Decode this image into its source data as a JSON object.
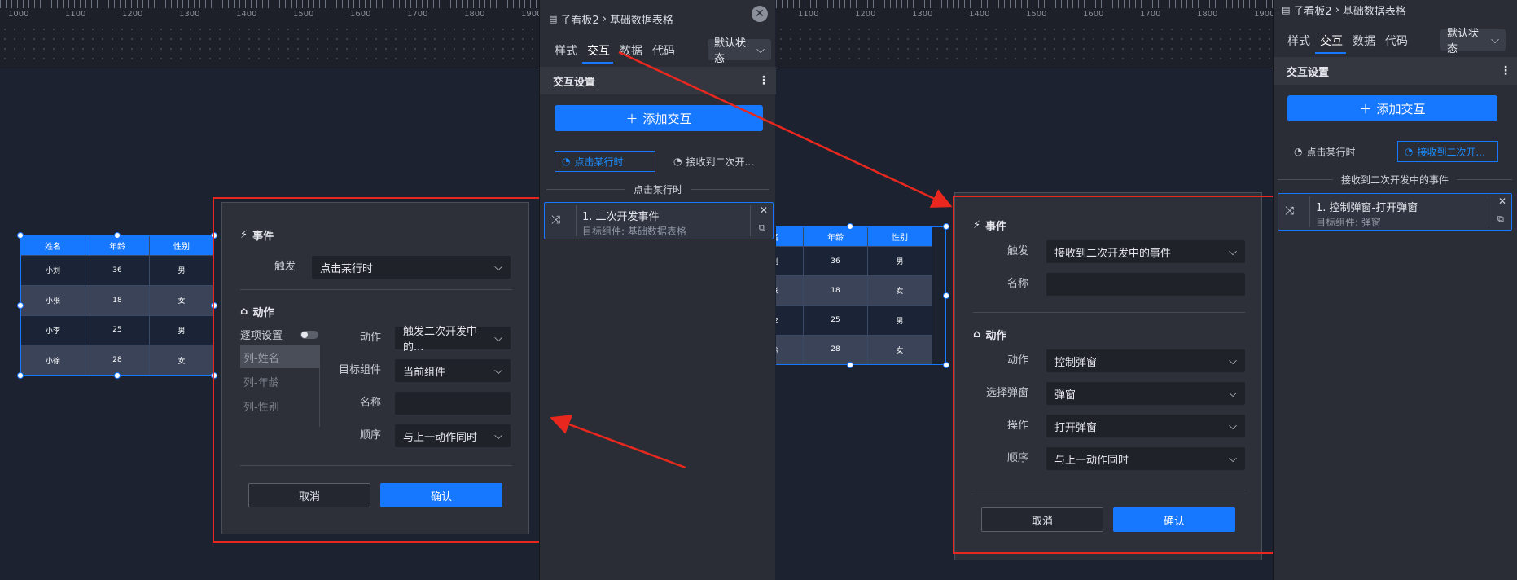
{
  "left_ruler": [
    "1000",
    "1100",
    "1200",
    "1300",
    "1400",
    "1500",
    "1600",
    "1700",
    "1800",
    "1900"
  ],
  "right_ruler": [
    "1100",
    "1200",
    "1300",
    "1400",
    "1500",
    "1600",
    "1700",
    "1800",
    "1900"
  ],
  "table": {
    "headers": [
      "姓名",
      "年龄",
      "性别"
    ],
    "rows": [
      [
        "小刘",
        "36",
        "男"
      ],
      [
        "小张",
        "18",
        "女"
      ],
      [
        "小李",
        "25",
        "男"
      ],
      [
        "小徐",
        "28",
        "女"
      ]
    ]
  },
  "panel_a": {
    "breadcrumb_parent": "子看板2",
    "breadcrumb_current": "基础数据表格",
    "tabs": [
      "样式",
      "交互",
      "数据",
      "代码"
    ],
    "state": "默认状态",
    "section_title": "交互设置",
    "add_button": "添加交互",
    "trigger_click": "点击某行时",
    "trigger_receive": "接收到二次开...",
    "group_label": "点击某行时",
    "card_title": "1. 二次开发事件",
    "card_sub": "目标组件: 基础数据表格"
  },
  "panel_b": {
    "breadcrumb_parent": "子看板2",
    "breadcrumb_current": "基础数据表格",
    "tabs": [
      "样式",
      "交互",
      "数据",
      "代码"
    ],
    "state": "默认状态",
    "section_title": "交互设置",
    "add_button": "添加交互",
    "trigger_click": "点击某行时",
    "trigger_receive": "接收到二次开...",
    "group_label": "接收到二次开发中的事件",
    "card_title": "1. 控制弹窗-打开弹窗",
    "card_sub": "目标组件: 弹窗"
  },
  "dialog_a": {
    "event_title": "事件",
    "trigger_label": "触发",
    "trigger_value": "点击某行时",
    "action_title": "动作",
    "per_item": "逐项设置",
    "columns": [
      "列-姓名",
      "列-年龄",
      "列-性别"
    ],
    "action_label": "动作",
    "action_value": "触发二次开发中的...",
    "target_label": "目标组件",
    "target_value": "当前组件",
    "name_label": "名称",
    "name_value": "",
    "order_label": "顺序",
    "order_value": "与上一动作同时",
    "cancel": "取消",
    "confirm": "确认"
  },
  "dialog_b": {
    "event_title": "事件",
    "trigger_label": "触发",
    "trigger_value": "接收到二次开发中的事件",
    "name_label": "名称",
    "name_value": "",
    "action_title": "动作",
    "action_label": "动作",
    "action_value": "控制弹窗",
    "popup_label": "选择弹窗",
    "popup_value": "弹窗",
    "op_label": "操作",
    "op_value": "打开弹窗",
    "order_label": "顺序",
    "order_value": "与上一动作同时",
    "cancel": "取消",
    "confirm": "确认"
  },
  "colors": {
    "accent": "#1677ff",
    "annotation": "#e8281e",
    "panel": "#2a2d35",
    "canvas": "#1c2230"
  }
}
